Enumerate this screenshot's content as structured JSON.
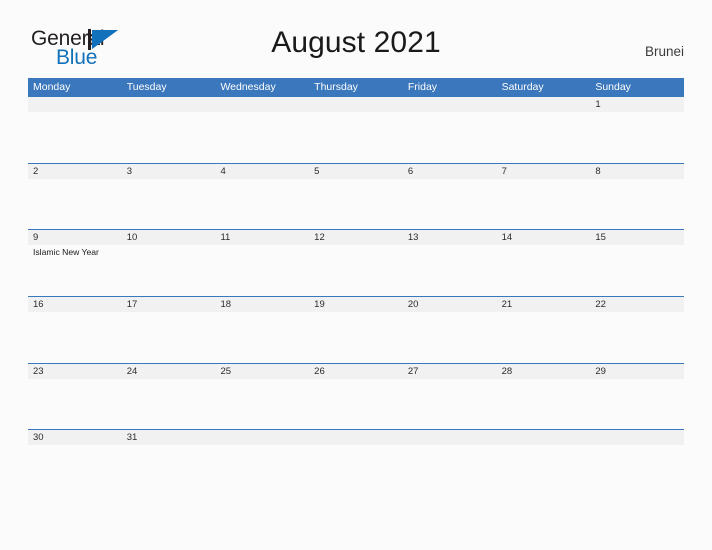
{
  "brand": {
    "word_one": "General",
    "word_two": "Blue",
    "mark": "flag-triangle",
    "color_dark": "#231f20",
    "color_blue": "#1271bb"
  },
  "header": {
    "title": "August 2021",
    "country": "Brunei"
  },
  "calendar": {
    "header_bg": "#3b77bc",
    "band_bg": "#f1f1f1",
    "grid_line": "#3b77bc",
    "day_names": [
      "Monday",
      "Tuesday",
      "Wednesday",
      "Thursday",
      "Friday",
      "Saturday",
      "Sunday"
    ],
    "weeks": [
      [
        {
          "date": ""
        },
        {
          "date": ""
        },
        {
          "date": ""
        },
        {
          "date": ""
        },
        {
          "date": ""
        },
        {
          "date": ""
        },
        {
          "date": "1"
        }
      ],
      [
        {
          "date": "2"
        },
        {
          "date": "3"
        },
        {
          "date": "4"
        },
        {
          "date": "5"
        },
        {
          "date": "6"
        },
        {
          "date": "7"
        },
        {
          "date": "8"
        }
      ],
      [
        {
          "date": "9",
          "event": "Islamic New Year"
        },
        {
          "date": "10"
        },
        {
          "date": "11"
        },
        {
          "date": "12"
        },
        {
          "date": "13"
        },
        {
          "date": "14"
        },
        {
          "date": "15"
        }
      ],
      [
        {
          "date": "16"
        },
        {
          "date": "17"
        },
        {
          "date": "18"
        },
        {
          "date": "19"
        },
        {
          "date": "20"
        },
        {
          "date": "21"
        },
        {
          "date": "22"
        }
      ],
      [
        {
          "date": "23"
        },
        {
          "date": "24"
        },
        {
          "date": "25"
        },
        {
          "date": "26"
        },
        {
          "date": "27"
        },
        {
          "date": "28"
        },
        {
          "date": "29"
        }
      ],
      [
        {
          "date": "30"
        },
        {
          "date": "31"
        },
        {
          "date": ""
        },
        {
          "date": ""
        },
        {
          "date": ""
        },
        {
          "date": ""
        },
        {
          "date": ""
        }
      ]
    ]
  }
}
